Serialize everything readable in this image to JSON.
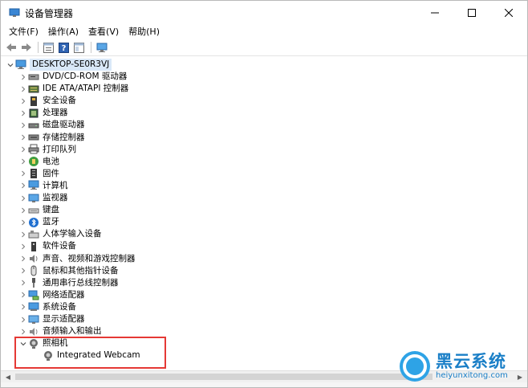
{
  "window": {
    "title": "设备管理器",
    "icon": "device-manager-icon",
    "controls": [
      "minimize-icon",
      "maximize-icon",
      "close-icon"
    ]
  },
  "menu": {
    "items": [
      "文件(F)",
      "操作(A)",
      "查看(V)",
      "帮助(H)"
    ]
  },
  "toolbar": {
    "buttons": [
      "back-arrow-icon",
      "forward-arrow-icon",
      "properties-icon",
      "help-icon",
      "view-icon",
      "monitor-icon"
    ]
  },
  "tree": {
    "root": "DESKTOP-SE0R3VJ",
    "categories": [
      {
        "label": "DVD/CD-ROM 驱动器",
        "icon": "dvd-drive-icon"
      },
      {
        "label": "IDE ATA/ATAPI 控制器",
        "icon": "ide-controller-icon"
      },
      {
        "label": "安全设备",
        "icon": "security-device-icon"
      },
      {
        "label": "处理器",
        "icon": "processor-icon"
      },
      {
        "label": "磁盘驱动器",
        "icon": "disk-drive-icon"
      },
      {
        "label": "存储控制器",
        "icon": "storage-controller-icon"
      },
      {
        "label": "打印队列",
        "icon": "printer-icon"
      },
      {
        "label": "电池",
        "icon": "battery-icon"
      },
      {
        "label": "固件",
        "icon": "firmware-icon"
      },
      {
        "label": "计算机",
        "icon": "computer-icon"
      },
      {
        "label": "监视器",
        "icon": "monitor-icon"
      },
      {
        "label": "键盘",
        "icon": "keyboard-icon"
      },
      {
        "label": "蓝牙",
        "icon": "bluetooth-icon"
      },
      {
        "label": "人体学输入设备",
        "icon": "hid-icon"
      },
      {
        "label": "软件设备",
        "icon": "software-device-icon"
      },
      {
        "label": "声音、视频和游戏控制器",
        "icon": "sound-icon"
      },
      {
        "label": "鼠标和其他指针设备",
        "icon": "mouse-icon"
      },
      {
        "label": "通用串行总线控制器",
        "icon": "usb-icon"
      },
      {
        "label": "网络适配器",
        "icon": "network-adapter-icon"
      },
      {
        "label": "系统设备",
        "icon": "system-device-icon"
      },
      {
        "label": "显示适配器",
        "icon": "display-adapter-icon"
      },
      {
        "label": "音频输入和输出",
        "icon": "audio-io-icon"
      }
    ],
    "expanded": {
      "label": "照相机",
      "icon": "camera-icon",
      "child": "Integrated Webcam"
    }
  },
  "watermark": {
    "name": "黑云系统",
    "url": "heiyunxitong.com"
  },
  "colors": {
    "selection": "#d9e8f8",
    "highlight_box": "#e53935",
    "watermark": "#1a7fc7"
  }
}
